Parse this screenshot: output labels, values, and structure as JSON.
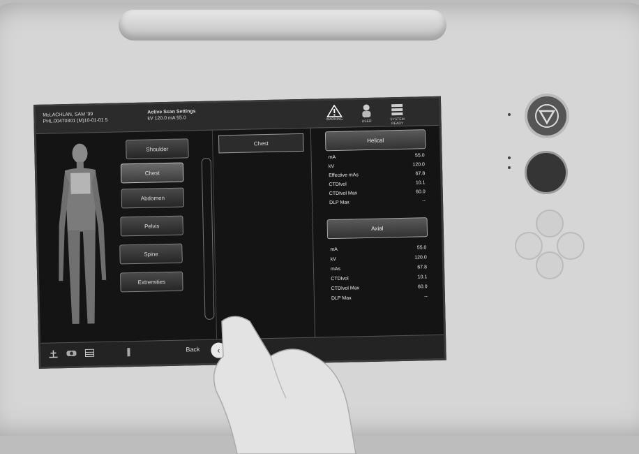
{
  "header": {
    "patient_line1": "McLACHLAN, SAM ‘99",
    "patient_line2": "PHL.00470301 (M)10-01-01 5",
    "protocol_title": "Active Scan Settings",
    "protocol_sub": "kV 120.0  mA 55.0",
    "warning_label": "WARNING",
    "user_label": "USER",
    "status_label": "SYSTEM READY"
  },
  "regions": {
    "items": [
      "Shoulder",
      "Chest",
      "Abdomen",
      "Pelvis",
      "Spine",
      "Extremities"
    ],
    "selected_index": 1
  },
  "middle": {
    "selected_label": "Chest"
  },
  "helical": {
    "label": "Helical",
    "params": [
      {
        "k": "mA",
        "v": "55.0"
      },
      {
        "k": "kV",
        "v": "120.0"
      },
      {
        "k": "Effective mAs",
        "v": "67.8"
      },
      {
        "k": "CTDIvol",
        "v": "10.1"
      },
      {
        "k": "CTDIvol Max",
        "v": "60.0"
      },
      {
        "k": "DLP Max",
        "v": "--"
      }
    ]
  },
  "axial": {
    "label": "Axial",
    "params": [
      {
        "k": "mA",
        "v": "55.0"
      },
      {
        "k": "kV",
        "v": "120.0"
      },
      {
        "k": "mAs",
        "v": "67.8"
      },
      {
        "k": "CTDIvol",
        "v": "10.1"
      },
      {
        "k": "CTDIvol Max",
        "v": "60.0"
      },
      {
        "k": "DLP Max",
        "v": "--"
      }
    ]
  },
  "bottom": {
    "back_label": "Back"
  }
}
